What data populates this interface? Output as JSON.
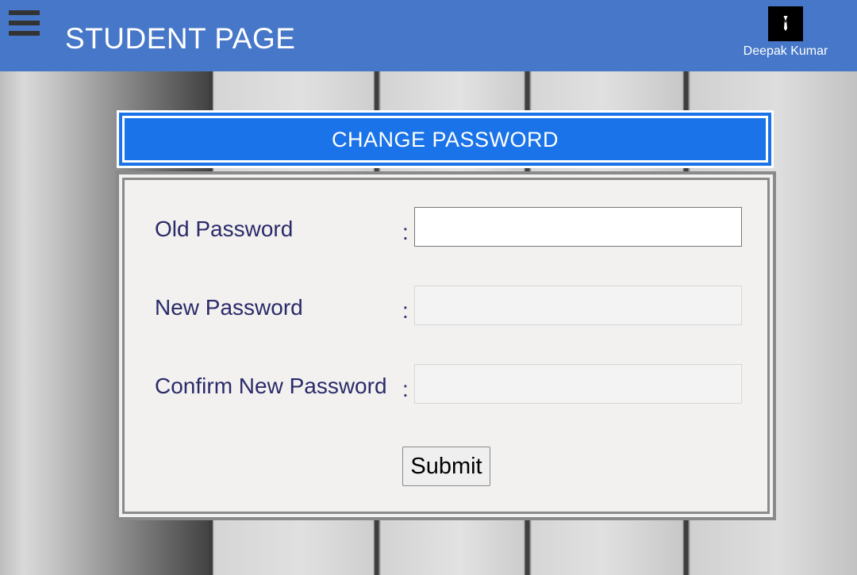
{
  "header": {
    "title": "STUDENT PAGE",
    "menu_icon": "hamburger-menu-icon",
    "user_name": "Deepak Kumar",
    "avatar_icon": "user-avatar-icon",
    "bg_color": "#4677c8"
  },
  "card": {
    "title": "CHANGE PASSWORD",
    "title_bg_color": "#1a73e8"
  },
  "form": {
    "fields": [
      {
        "label": "Old Password",
        "colon": ":",
        "value": "",
        "enabled": true
      },
      {
        "label": "New Password",
        "colon": ":",
        "value": "",
        "enabled": false
      },
      {
        "label": "Confirm New Password",
        "colon": ":",
        "value": "",
        "enabled": false
      }
    ],
    "submit_label": "Submit"
  }
}
